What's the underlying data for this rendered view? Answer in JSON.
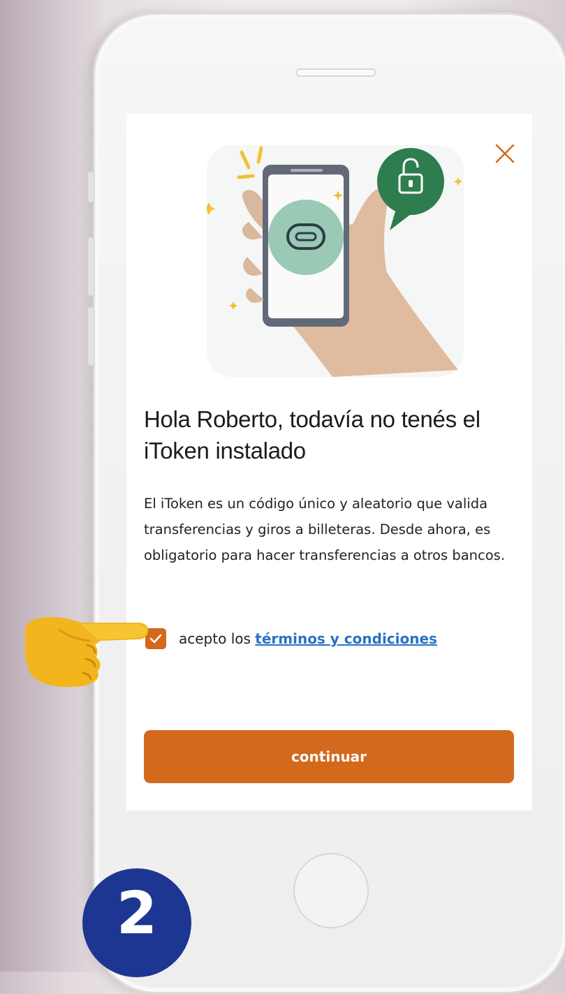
{
  "modal": {
    "title": "Hola Roberto, todavía no tenés el iToken instalado",
    "description": "El iToken es un código único y aleatorio que valida transferencias y giros a billeteras. Desde ahora, es obligatorio para hacer transferencias a otros bancos.",
    "terms_checkbox": {
      "checked": true,
      "prefix": "acepto los ",
      "link_text": "términos y condiciones"
    },
    "continue_label": "continuar"
  },
  "step_badge": {
    "number": "2"
  },
  "colors": {
    "accent_orange": "#d2691d",
    "link_blue": "#2a72c3",
    "badge_navy": "#1d3691",
    "lock_green": "#2e7d4f"
  },
  "icons": {
    "close": "close-icon",
    "checkbox": "checkmark-icon",
    "lock": "lock-icon",
    "pointer": "pointing-hand-icon"
  }
}
